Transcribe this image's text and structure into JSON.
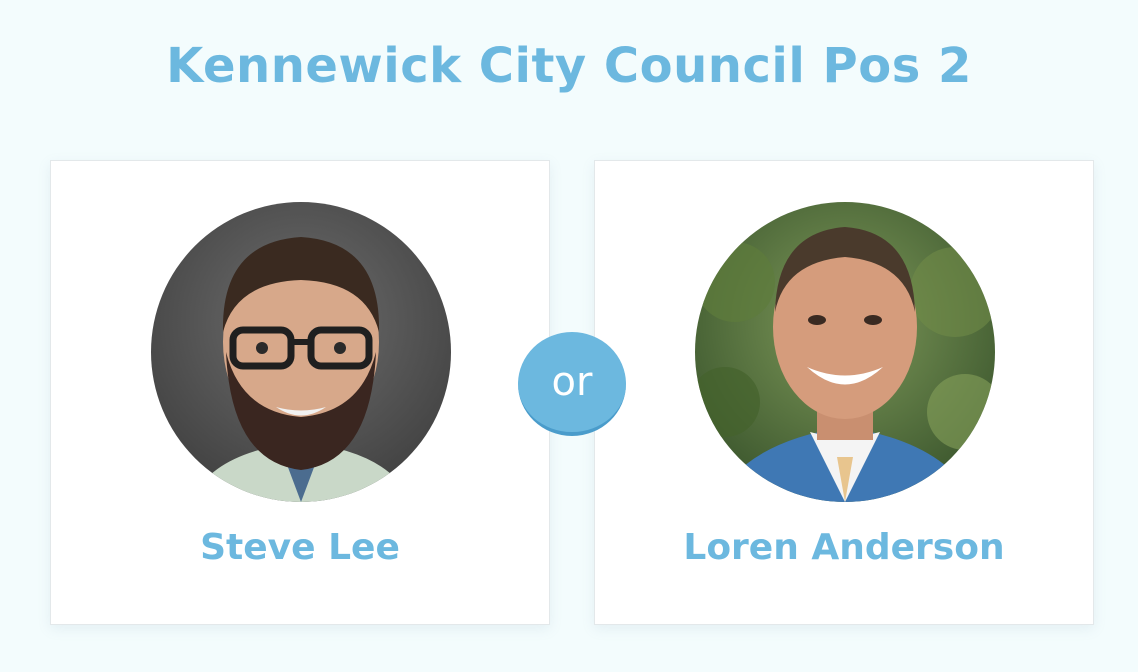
{
  "title": "Kennewick City Council Pos 2",
  "separator": "or",
  "candidates": [
    {
      "name": "Steve Lee"
    },
    {
      "name": "Loren Anderson"
    }
  ],
  "colors": {
    "accent": "#6cb8df",
    "background": "#f3fcfd",
    "card": "#ffffff"
  }
}
